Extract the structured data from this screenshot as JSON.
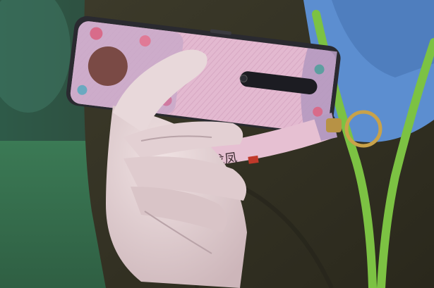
{
  "image": {
    "strap_text": "龙凤",
    "colors": {
      "background_left": "#2e5a48",
      "background_floor": "#3b7a55",
      "jacket": "#3c3a2a",
      "phone_case": "#e3b9d0",
      "phone_frame": "#2a2a30",
      "glove": "#e6d3d6",
      "strap": "#e6c0d2",
      "lanyard": "#7cc243",
      "ring": "#c8a24a",
      "mask": "#5c8ed0"
    }
  }
}
